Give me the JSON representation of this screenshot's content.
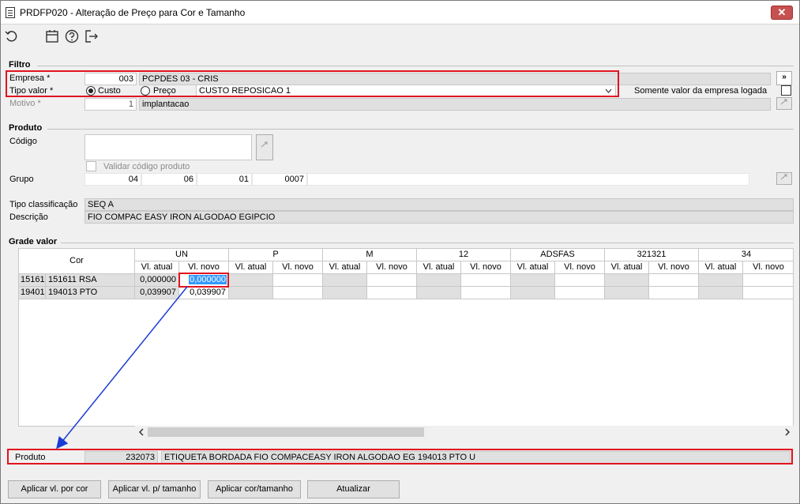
{
  "window": {
    "title": "PRDFP020 - Alteração de Preço para Cor e Tamanho",
    "close_label": "✕"
  },
  "toolbar": {
    "icons": [
      "undo-icon",
      "calendar-icon",
      "help-icon",
      "exit-icon"
    ]
  },
  "filtro": {
    "title": "Filtro",
    "empresa_label": "Empresa *",
    "empresa_code": "003",
    "empresa_name": "PCPDES 03 - CRIS",
    "tipo_valor_label": "Tipo valor *",
    "custo_label": "Custo",
    "preco_label": "Preço",
    "tipo_selected": "Custo",
    "tipo_select_value": "CUSTO REPOSICAO 1",
    "somente_label": "Somente valor da empresa logada",
    "motivo_label": "Motivo *",
    "motivo_code": "1",
    "motivo_name": "implantacao",
    "expand_label": "»"
  },
  "produto": {
    "title": "Produto",
    "codigo_label": "Código",
    "validar_label": "Validar código produto",
    "grupo_label": "Grupo",
    "grupo_values": [
      "04",
      "06",
      "01",
      "0007"
    ],
    "tipo_class_label": "Tipo classificação",
    "tipo_class_value": "SEQ A",
    "descricao_label": "Descrição",
    "descricao_value": "FIO COMPAC EASY IRON ALGODAO EGIPCIO"
  },
  "grade": {
    "title": "Grade valor",
    "cor_header": "Cor",
    "sizes": [
      "UN",
      "P",
      "M",
      "12",
      "ADSFAS",
      "321321",
      "34"
    ],
    "vl_atual": "Vl. atual",
    "vl_novo": "Vl. novo",
    "rows": [
      {
        "code": "15161",
        "name": "151611 RSA",
        "atual": "0,000000",
        "novo": "0,000000"
      },
      {
        "code": "19401",
        "name": "194013 PTO",
        "atual": "0,039907",
        "novo": "0,039907"
      }
    ]
  },
  "footer": {
    "produto_label": "Produto",
    "produto_code": "232073",
    "produto_desc": "ETIQUETA BORDADA FIO COMPACEASY IRON ALGODAO EG 194013 PTO U"
  },
  "buttons": {
    "aplicar_cor": "Aplicar vl. por cor",
    "aplicar_tamanho": "Aplicar vl. p/ tamanho",
    "aplicar_cor_tamanho": "Aplicar cor/tamanho",
    "atualizar": "Atualizar"
  },
  "colors": {
    "highlight_red": "#e0141e",
    "arrow_blue": "#1a3cd6",
    "selection_blue": "#3399ff"
  }
}
